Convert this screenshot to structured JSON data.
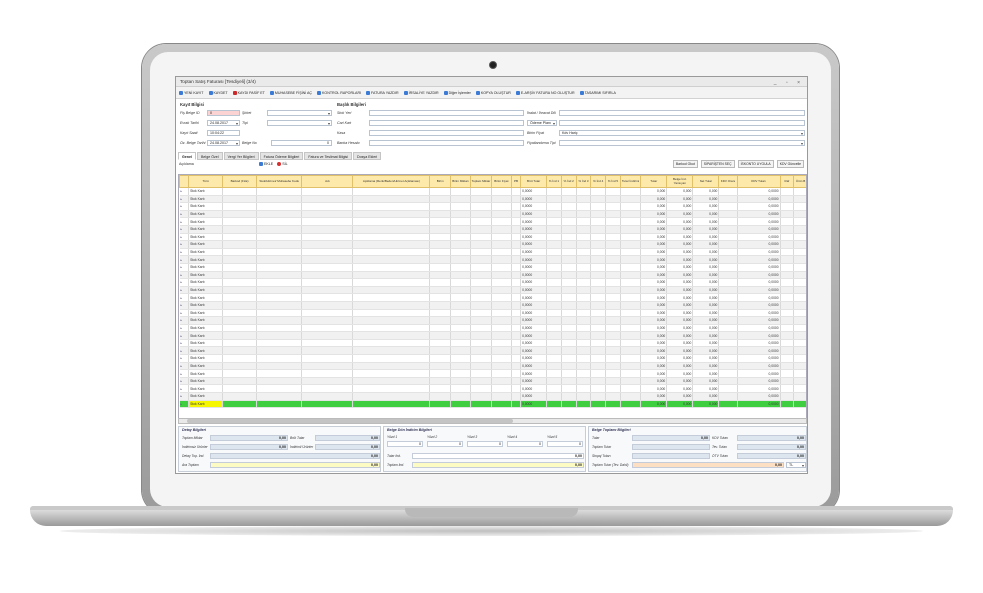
{
  "window": {
    "title": "Toptan Satış Faturası [Tesdiyeli] (3/4)",
    "controls": "_ ▫ ×"
  },
  "toolbar": [
    {
      "label": "YENİ KAYIT",
      "color": "#3b7bd6"
    },
    {
      "label": "KAYDET",
      "color": "#3b7bd6"
    },
    {
      "label": "KAYDI PASİF ET",
      "color": "#cc2a2a"
    },
    {
      "label": "MUHASEBE FİŞİNİ AÇ",
      "color": "#3b7bd6"
    },
    {
      "label": "KONTROL RAPORLARI",
      "color": "#3b7bd6"
    },
    {
      "label": "FATURA YAZDIR",
      "color": "#3b7bd6"
    },
    {
      "label": "İRSALİYE YAZDIR",
      "color": "#3b7bd6"
    },
    {
      "label": "Diğer İşlemler",
      "color": "#3b7bd6"
    },
    {
      "label": "KOPYA OLUŞTUR",
      "color": "#3b7bd6"
    },
    {
      "label": "E-ARŞİV FATURA NO OLUŞTUR",
      "color": "#3b7bd6"
    },
    {
      "label": "TASARIMI SIFIRLA",
      "color": "#3b7bd6"
    }
  ],
  "kayit": {
    "section": "Kayıt Bilgisi",
    "fis_label": "Fiş Belge ID",
    "fis_value": "0",
    "sirket_label": "Şirket",
    "evrak_label": "Evrak Tarihi",
    "evrak_value": "24.08.2017",
    "tipi_label": "Tipi",
    "saat_label": "Kayıt Saati",
    "saat_value": "10:04:22",
    "ozel_label": "Öz. Belge Tarihi",
    "ozel_value": "24.08.2017",
    "belge_no_label": "Belge No",
    "belge_no_value": "0"
  },
  "baslik": {
    "section": "Başlık Bilgileri",
    "stok_yeri": "Stok Yeri",
    "ithalat": "İhalat / İhracat Dili",
    "cari_kart": "Cari Kart",
    "odeme_plani": "Ödeme Planı",
    "kasa": "Kasa",
    "birim_fiyat": "Birim Fiyat",
    "kdv_haric": "Kdv Hariç",
    "banka": "Banka Hesabı",
    "fiyatlandirma": "Fiyatlandırma Tipi"
  },
  "tabs": [
    "Genel",
    "Belge Özel",
    "Vergi Yer Bilgileri",
    "Fatura Ödeme Bilgileri",
    "Fatura ve Teslimat Bilgisi",
    "Dosya Ekleri"
  ],
  "aciklama_label": "Açıklama",
  "row_buttons": [
    "EKLE",
    "SİL"
  ],
  "grid_buttons": [
    "Barkod Okut",
    "SİPARİŞTEN SEÇ",
    "İSKONTO UYGULA",
    "KDV Güncelle"
  ],
  "columns": [
    "Türü",
    "Barkod (FLE)",
    "Stok/Hizmet/ Muhasebe Kodu",
    "Adı",
    "Açıklama (Renk/Beden/Hizmet Açıklaması)",
    "Birim",
    "Birim Miktarı",
    "Toplam Miktar",
    "Birim Fiyat",
    "PB",
    "Brüt Tutar",
    "% İnd 1",
    "% İnd 2",
    "% İnd 3",
    "% İnd 4",
    "% İnd 5",
    "Tutar İndirimi",
    "Tutar",
    "Belge İnd. Yansıyan",
    "Net Tutar",
    "KDV Oranı",
    "KDV Tutarı",
    "Raf",
    "Ürün B"
  ],
  "row_type": "Stok Kartı",
  "row_values": {
    "brut": "0,0000",
    "tutar": "0,000",
    "yansiyan": "0,000",
    "net": "0,000",
    "kdv": "0,0000"
  },
  "row_count": 29,
  "detay": {
    "title": "Detay Bilgileri",
    "toplam_miktar": "Toplam Miktar",
    "toplam_miktar_v": "0,00",
    "brut_tutar": "Brüt Tutar",
    "brut_tutar_v": "0,00",
    "indirimsiz": "İndirimsiz Ürünler",
    "indirimsiz_v": "0,00",
    "indirimli": "İndirimli Ürünler",
    "indirimli_v": "0,00",
    "detay_top": "Detay Top. İnd.",
    "detay_top_v": "0,00",
    "ara_toplam": "Ara Toplam",
    "ara_toplam_v": "0,00"
  },
  "belge_alt": {
    "title": "Belge Dön İndirim Bilgileri",
    "cols": [
      "Yüzd 1",
      "Yüzd 2",
      "Yüzd 3",
      "Yüzd 4",
      "Yüzd 5"
    ],
    "zero": "0",
    "tutar_ind": "Tutar İnd.",
    "tutar_ind_v": "0,00",
    "toplam_ind": "Toplam İnd.",
    "toplam_ind_v": "0,00"
  },
  "belge_top": {
    "title": "Belge Toplamı Bilgileri",
    "tutar": "Tutar",
    "tutar_v": "0,00",
    "kdv_tutari": "KDV Tutarı",
    "kdv_tutari_v": "0,00",
    "toplam_tutar": "Toplam Tutar",
    "tev_tutari": "Tev. Tutarı",
    "tev_tutari_v": "0,00",
    "stopaj": "Stopaj Tutarı",
    "otv": "ÖTV Tutarı",
    "otv_v": "0,00",
    "toplam_tev": "Toplam Tutar (Tev. Dahil)",
    "toplam_tev_v": "0,00",
    "currency": "TL"
  }
}
